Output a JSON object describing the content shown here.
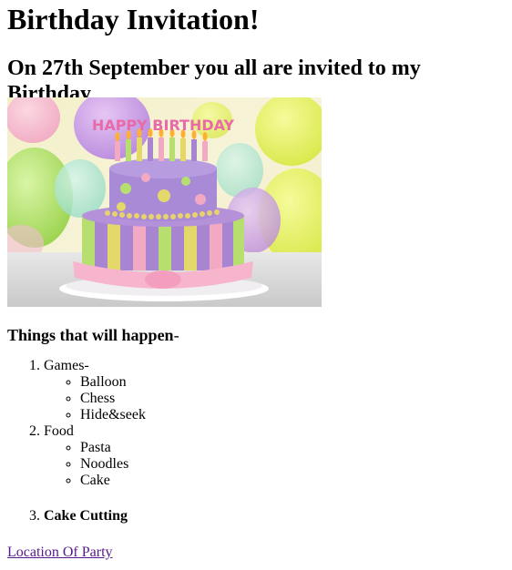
{
  "page": {
    "title": "Birthday Invitation!",
    "subtitle": "On 27th September you all are invited to my Birthday",
    "image_banner_text": "HAPPY BIRTHDAY",
    "section_heading": "Things that will happen",
    "section_heading_suffix": "-"
  },
  "events": {
    "games": {
      "label": "Games-",
      "items": [
        "Balloon",
        "Chess",
        "Hide&seek"
      ]
    },
    "food": {
      "label": "Food",
      "items": [
        "Pasta",
        "Noodles",
        "Cake"
      ]
    },
    "cake_cutting": {
      "label": "Cake Cutting"
    }
  },
  "link": {
    "label": "Location Of Party"
  }
}
